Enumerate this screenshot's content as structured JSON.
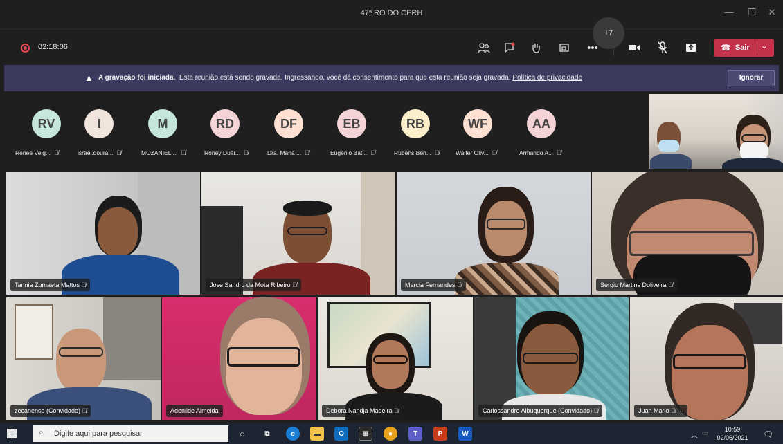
{
  "window": {
    "title": "47ª RO DO CERH",
    "minimize_icon": "minimize-icon",
    "maximize_icon": "maximize-icon",
    "close_icon": "close-icon"
  },
  "meeting_bar": {
    "timer": "02:18:06",
    "leave_label": "Sair"
  },
  "banner": {
    "bold_text": "A gravação foi iniciada.",
    "text": "Esta reunião está sendo gravada. Ingressando, você dá consentimento para que esta reunião seja gravada.",
    "link_text": "Política de privacidade",
    "ignore_label": "Ignorar"
  },
  "avatars": [
    {
      "initials": "RV",
      "name": "Renée Veig...",
      "color": "#c5e6d8"
    },
    {
      "initials": "I",
      "name": "israel.doura...",
      "color": "#f1e4dc"
    },
    {
      "initials": "M",
      "name": "MOZANIEL ...",
      "color": "#c5e6d8"
    },
    {
      "initials": "RD",
      "name": "Roney Duar...",
      "color": "#f4d3d6"
    },
    {
      "initials": "DF",
      "name": "Dra. Maria ...",
      "color": "#fde0d2"
    },
    {
      "initials": "EB",
      "name": "Eugênio Bat...",
      "color": "#f4d3d6"
    },
    {
      "initials": "RB",
      "name": "Rubens Ben...",
      "color": "#fbeecb"
    },
    {
      "initials": "WF",
      "name": "Walter Oliv...",
      "color": "#fde0d2"
    },
    {
      "initials": "AA",
      "name": "Armando A...",
      "color": "#f4d3d6"
    }
  ],
  "more_count": "+7",
  "tiles": [
    {
      "name": "Tannia Zumaeta Mattos"
    },
    {
      "name": "Jose Sandro da Mota Ribeiro"
    },
    {
      "name": "Marcia Fernandes"
    },
    {
      "name": "Sergio Martins Doliveira"
    },
    {
      "name": "zecanense (Convidado)"
    },
    {
      "name": "Adenilde Almeida"
    },
    {
      "name": "Debora Nandja Madeira"
    },
    {
      "name": "Carlossandro Albuquerque (Convidado)"
    },
    {
      "name": "Juan Mario"
    }
  ],
  "taskbar": {
    "search_placeholder": "Digite aqui para pesquisar",
    "time": "10:59",
    "date": "02/06/2021"
  },
  "colors": {
    "accent_leave": "#c4314b",
    "banner_bg": "#3b3a5e",
    "recording_red": "#e04a53"
  }
}
